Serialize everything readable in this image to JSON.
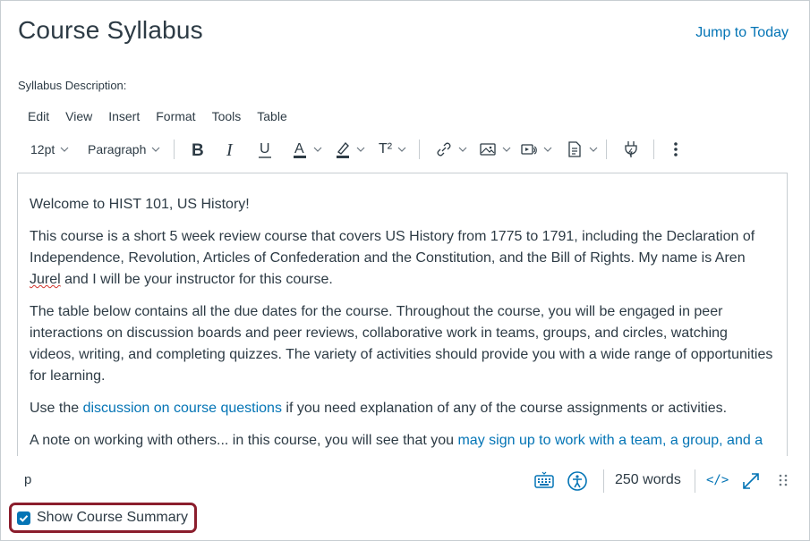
{
  "header": {
    "title": "Course Syllabus",
    "jump_link": "Jump to Today"
  },
  "syllabus_label": "Syllabus Description:",
  "menubar": [
    "Edit",
    "View",
    "Insert",
    "Format",
    "Tools",
    "Table"
  ],
  "toolbar": {
    "font_size": "12pt",
    "block_format": "Paragraph",
    "superscript_label": "T²",
    "icons": [
      "bold-icon",
      "italic-icon",
      "underline-icon",
      "text-color-icon",
      "highlight-icon",
      "superscript-icon",
      "link-icon",
      "image-icon",
      "media-icon",
      "document-icon",
      "plugin-icon",
      "more-options-icon"
    ]
  },
  "content": {
    "p1": "Welcome to HIST 101, US History!",
    "p2_before": "This course is a short 5 week review course that covers US History from 1775 to 1791, including the Declaration of Independence, Revolution, Articles of Confederation and the Constitution, and the Bill of Rights. My name is Aren ",
    "p2_misspelled": "Jurel",
    "p2_after": " and I will be your instructor for this course.",
    "p3": "The table below contains all the due dates for the course. Throughout the course, you will be engaged in peer interactions on discussion boards and peer reviews, collaborative work in teams, groups, and circles, watching videos, writing, and completing quizzes. The variety of activities should provide you with a wide range of opportunities for learning.",
    "p4_before": "Use the ",
    "p4_link": "discussion on course questions",
    "p4_after": " if you need explanation of any of the course assignments or activities.",
    "p5_before": "A note on working with others... in this course, you will see that you ",
    "p5_link": "may sign up to work with a team, a group, and a"
  },
  "statusbar": {
    "path": "p",
    "word_count": "250 words",
    "html_toggle": "</>",
    "icons": [
      "keyboard-icon",
      "accessibility-icon",
      "fullscreen-icon",
      "resize-handle-icon"
    ]
  },
  "summary": {
    "checked": true,
    "label": "Show Course Summary"
  },
  "colors": {
    "accent": "#0374b5",
    "text": "#2d3b45",
    "highlight_border": "#8b1e2d"
  }
}
